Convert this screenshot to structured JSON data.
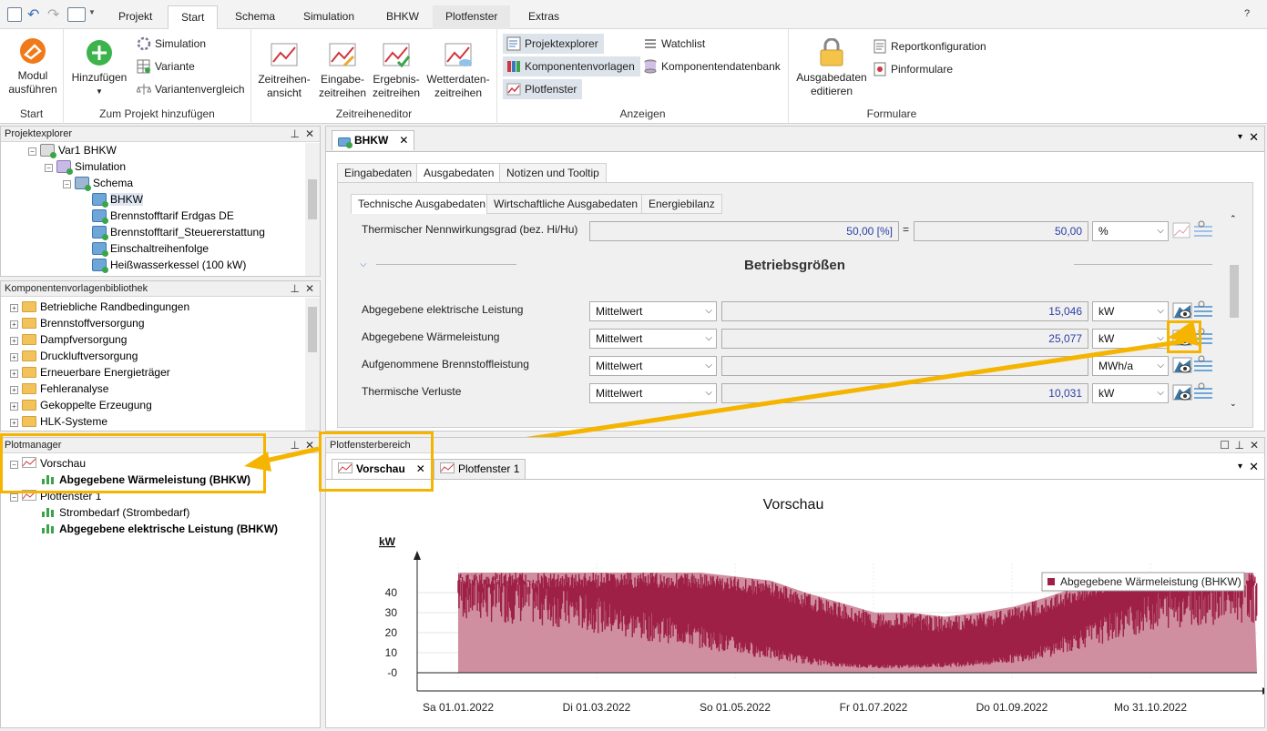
{
  "ribbon": {
    "tabs": [
      "Projekt",
      "Start",
      "Schema",
      "Simulation",
      "BHKW",
      "Plotfenster",
      "Extras"
    ],
    "active_tab": "Start",
    "groups": {
      "start": {
        "label": "Start",
        "module_button": "Modul\nausführen",
        "module_l1": "Modul",
        "module_l2": "ausführen"
      },
      "add": {
        "label": "Zum Projekt hinzufügen",
        "hinzufuegen": "Hinzufügen",
        "simulation": "Simulation",
        "variante": "Variante",
        "variantenvergleich": "Variantenvergleich"
      },
      "ts": {
        "label": "Zeitreiheneditor",
        "b1a": "Zeitreihen-",
        "b1b": "ansicht",
        "b2a": "Eingabe-",
        "b2b": "zeitreihen",
        "b3a": "Ergebnis-",
        "b3b": "zeitreihen",
        "b4a": "Wetterdaten-",
        "b4b": "zeitreihen"
      },
      "show": {
        "label": "Anzeigen",
        "projektexplorer": "Projektexplorer",
        "komponentenvorlagen": "Komponentenvorlagen",
        "plotfenster": "Plotfenster",
        "watchlist": "Watchlist",
        "komponentendatenbank": "Komponentendatenbank"
      },
      "forms": {
        "label": "Formulare",
        "ausg_a": "Ausgabedaten",
        "ausg_b": "editieren",
        "reportkonfiguration": "Reportkonfiguration",
        "pinformulare": "Pinformulare"
      }
    }
  },
  "projektexplorer": {
    "title": "Projektexplorer",
    "items": [
      "Var1 BHKW",
      "Simulation",
      "Schema",
      "BHKW",
      "Brennstofftarif Erdgas DE",
      "Brennstofftarif_Steuererstattung",
      "Einschaltreihenfolge",
      "Heißwasserkessel (100 kW)"
    ]
  },
  "bibliothek": {
    "title": "Komponentenvorlagenbibliothek",
    "items": [
      "Betriebliche Randbedingungen",
      "Brennstoffversorgung",
      "Dampfversorgung",
      "Druckluftversorgung",
      "Erneuerbare Energieträger",
      "Fehleranalyse",
      "Gekoppelte Erzeugung",
      "HLK-Systeme"
    ]
  },
  "plotmanager": {
    "title": "Plotmanager",
    "items": [
      "Vorschau",
      "Abgegebene Wärmeleistung (BHKW)",
      "Plotfenster 1",
      "Strombedarf  (Strombedarf)",
      "Abgegebene elektrische Leistung (BHKW)"
    ]
  },
  "editor": {
    "doc_tab": "BHKW",
    "tabs": [
      "Eingabedaten",
      "Ausgabedaten",
      "Notizen und Tooltip"
    ],
    "active_tab": "Ausgabedaten",
    "subtabs": [
      "Technische Ausgabedaten",
      "Wirtschaftliche Ausgabedaten",
      "Energiebilanz"
    ],
    "active_subtab": "Technische Ausgabedaten",
    "nenn": {
      "label": "Thermischer Nennwirkungsgrad (bez. Hi/Hu)",
      "value1": "50,00 [%]",
      "eq": "=",
      "value2": "50,00",
      "unit": "%"
    },
    "section": "Betriebsgrößen",
    "rows": [
      {
        "label": "Abgegebene elektrische Leistung",
        "mode": "Mittelwert",
        "value": "15,046",
        "unit": "kW"
      },
      {
        "label": "Abgegebene Wärmeleistung",
        "mode": "Mittelwert",
        "value": "25,077",
        "unit": "kW"
      },
      {
        "label": "Aufgenommene Brennstoffleistung",
        "mode": "Mittelwert",
        "value": "",
        "unit": "MWh/a"
      },
      {
        "label": "Thermische Verluste",
        "mode": "Mittelwert",
        "value": "10,031",
        "unit": "kW"
      }
    ]
  },
  "plotbereich": {
    "title": "Plotfensterbereich",
    "tabs": [
      "Vorschau",
      "Plotfenster 1"
    ],
    "active_tab": "Vorschau"
  },
  "colors": {
    "accent": "#f4b400",
    "series": "#9e2046",
    "series_fill": "#cf8fa0"
  },
  "chart_data": {
    "type": "area",
    "title": "Vorschau",
    "ylabel": "kW",
    "ylim": [
      0,
      50
    ],
    "yticks": [
      "40",
      "30",
      "20",
      "10",
      "-0"
    ],
    "xticks": [
      "Sa 01.01.2022",
      "Di 01.03.2022",
      "So 01.05.2022",
      "Fr 01.07.2022",
      "Do 01.09.2022",
      "Mo 31.10.2022"
    ],
    "legend": "top-right",
    "grid": true,
    "series": [
      {
        "name": "Abgegebene Wärmeleistung (BHKW)",
        "x_month": [
          1,
          1.5,
          2,
          2.5,
          3,
          3.5,
          4,
          4.5,
          5,
          5.5,
          6,
          6.5,
          7,
          7.5,
          8,
          8.5,
          9,
          9.5,
          10,
          10.5,
          11,
          11.5,
          12,
          12.5
        ],
        "baseline": [
          48,
          45,
          44,
          40,
          36,
          30,
          27,
          22,
          17,
          12,
          8,
          5,
          4,
          4,
          5,
          6,
          9,
          14,
          22,
          30,
          38,
          42,
          44,
          45
        ],
        "peak": [
          50,
          50,
          50,
          50,
          50,
          50,
          50,
          50,
          48,
          46,
          40,
          35,
          30,
          30,
          28,
          30,
          33,
          38,
          44,
          50,
          50,
          50,
          50,
          50
        ]
      }
    ]
  }
}
